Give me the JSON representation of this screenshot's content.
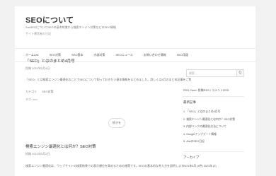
{
  "header": {
    "site_title": "SEOについて",
    "description": "ZacSEOについてSEOの基本知識から検索エンジン対策などのSEO情報",
    "description2": "サイト運営者の日記"
  },
  "nav": {
    "items": [
      "ホームZac",
      "SEO対策",
      "SEO基本",
      "内部対策",
      "SEOニュース",
      "お問い合わせ情報",
      "SEO用語"
    ]
  },
  "posts": [
    {
      "title": "「SEO」とはのまとめ4月号",
      "date": "投稿 2021年5月4日",
      "excerpt": "「SEO」とは検索エンジン最適化のことでSEOについて知っておきたい基本情報をまとめました。詳しくは4月のまとめ記事をご覧",
      "tags": [
        "カテゴリ",
        "SEO対策"
      ],
      "category": "タグ: seo"
    },
    {
      "title": "検索エンジン最適化とは何か？SEO対策",
      "date": "投稿 2021年5月2日",
      "excerpt": "検索エンジン最適化は、ウェブサイトの検索結果での表示順位を高めるための施策です。SEOの基本的な考え方を説明します"
    }
  ],
  "more_button": "続きを",
  "sidebar": {
    "search_placeholder": "検索 ...",
    "search_button": "Q",
    "feed_line": "RSS Feed: 投稿RSS / コメントRSS",
    "recent_title": "最新記事",
    "recent_items": [
      "1. 「SEO」とはのまとめ4月号",
      "2. 検索エンジン最適化とは何か？SEO対策",
      "3. 内部リンクの最適化方法について",
      "4. Googleアップデート情報",
      "5. ZacのSEO日記"
    ],
    "archive_title": "アーカイブ",
    "archive_items": [
      "2021年5月 (4件) 2021年 (2)"
    ]
  }
}
